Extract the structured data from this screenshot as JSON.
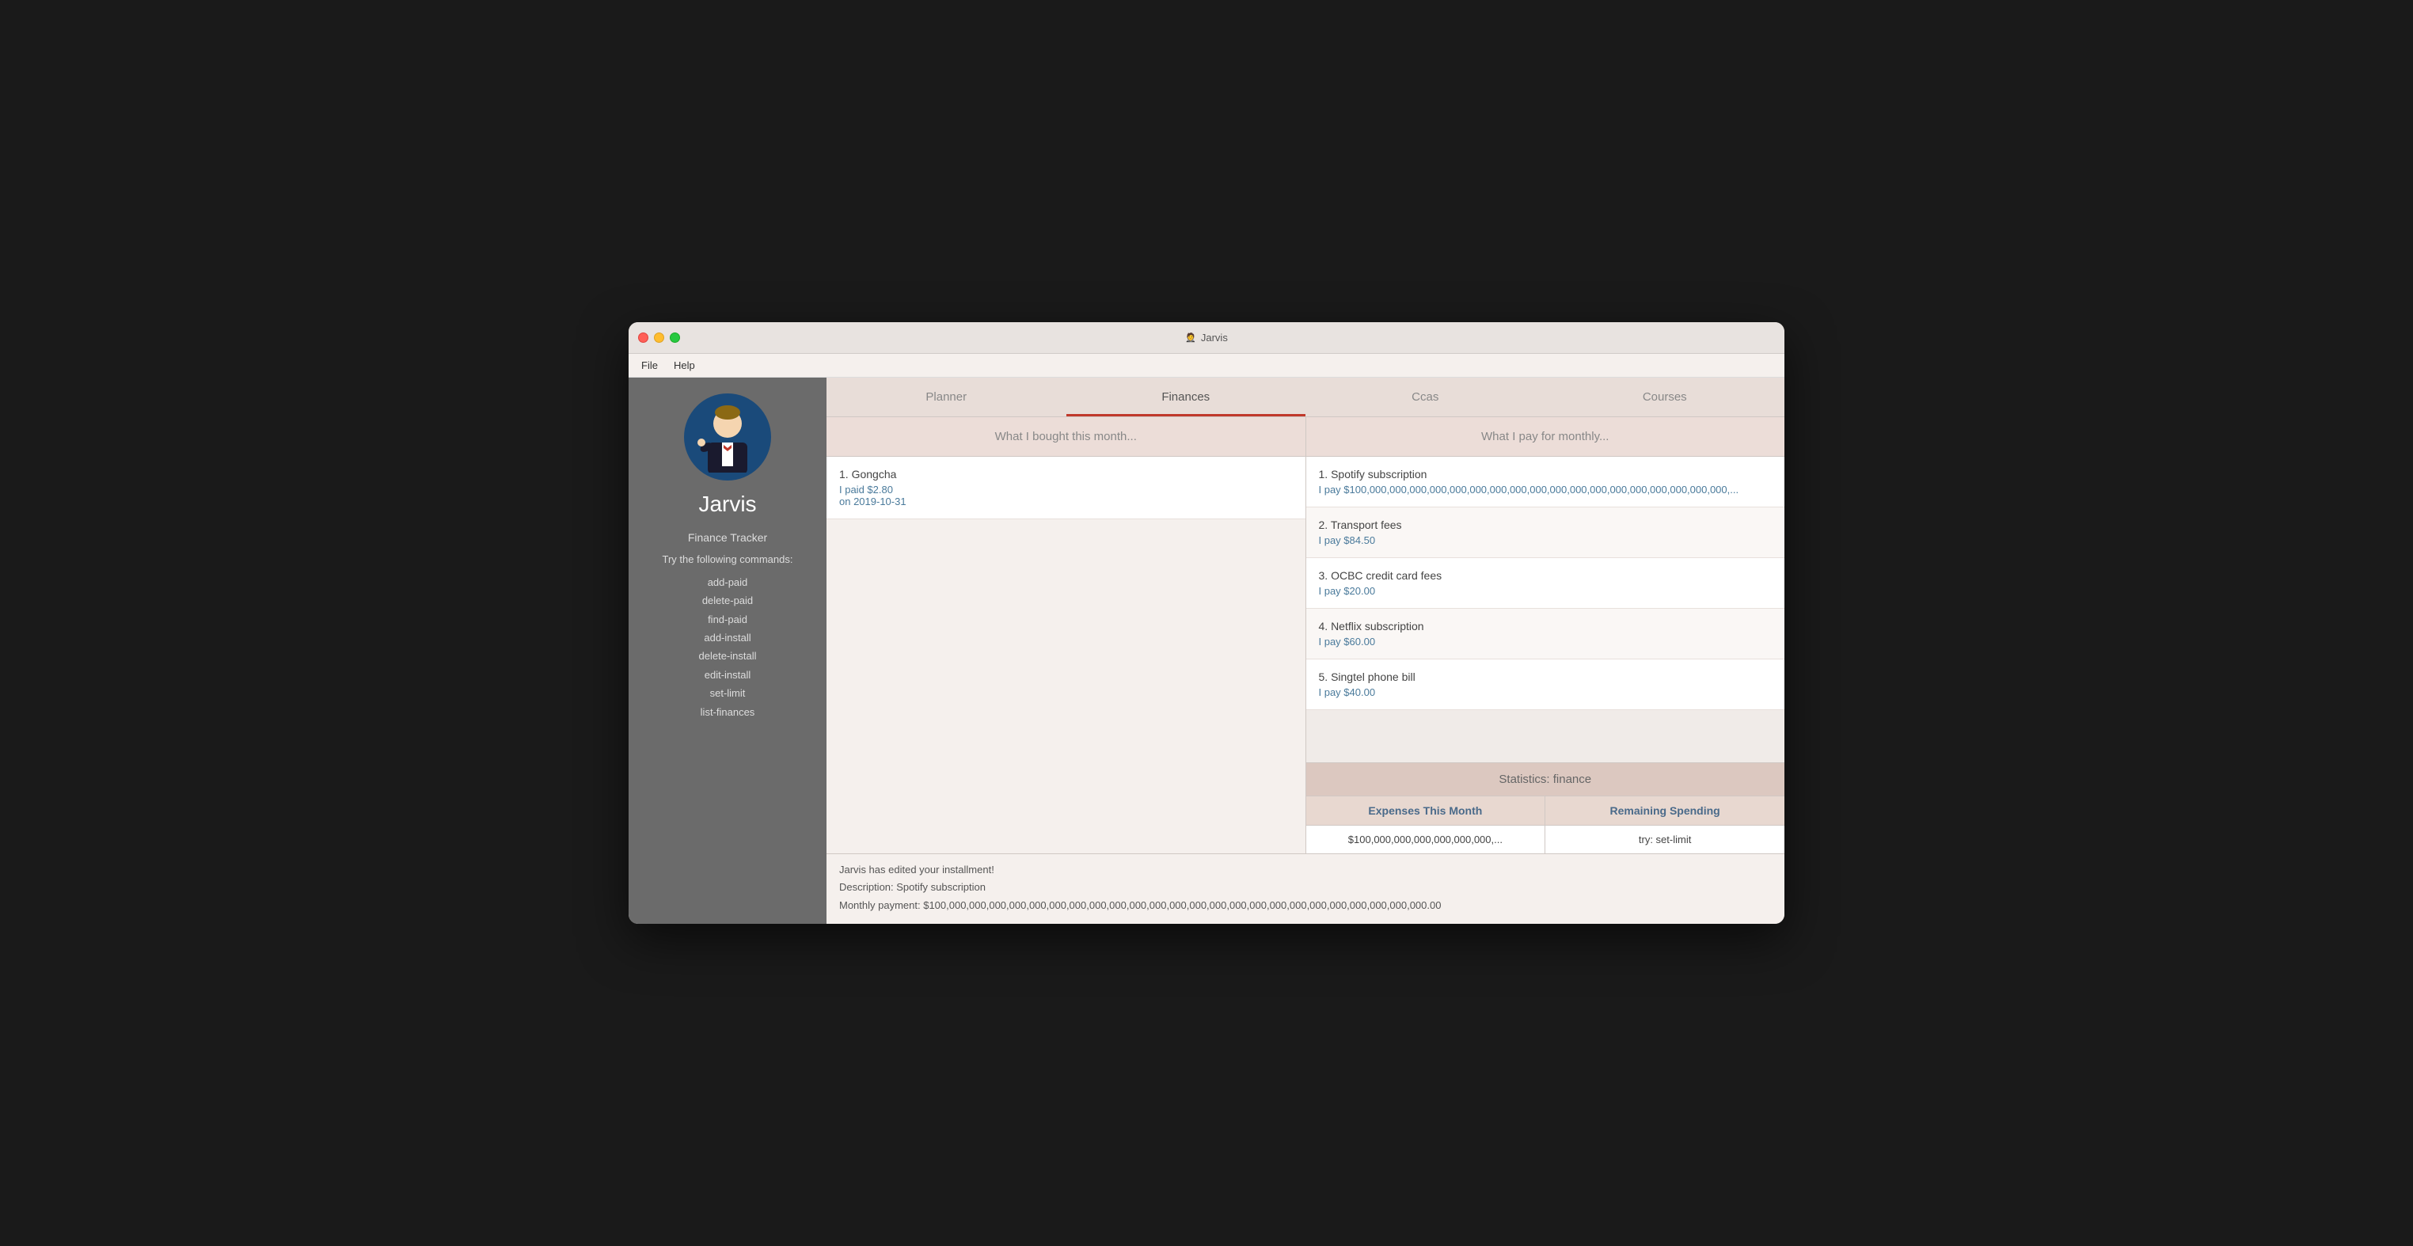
{
  "window": {
    "title": "Jarvis",
    "title_icon": "🤵"
  },
  "menubar": {
    "items": [
      "File",
      "Help"
    ]
  },
  "sidebar": {
    "name": "Jarvis",
    "section_title": "Finance Tracker",
    "commands_intro": "Try the following commands:",
    "commands": [
      "add-paid",
      "delete-paid",
      "find-paid",
      "add-install",
      "delete-install",
      "edit-install",
      "set-limit",
      "list-finances"
    ]
  },
  "tabs": [
    {
      "label": "Planner",
      "active": false
    },
    {
      "label": "Finances",
      "active": true
    },
    {
      "label": "Ccas",
      "active": false
    },
    {
      "label": "Courses",
      "active": false
    }
  ],
  "left_panel": {
    "header": "What I bought this month...",
    "items": [
      {
        "title": "1. Gongcha",
        "detail_line1": "I paid $2.80",
        "detail_line2": "on 2019-10-31"
      }
    ]
  },
  "right_panel": {
    "header": "What I pay for monthly...",
    "items": [
      {
        "title": "1. Spotify subscription",
        "detail": "I pay $100,000,000,000,000,000,000,000,000,000,000,000,000,000,000,000,000,000,000,..."
      },
      {
        "title": "2.  Transport fees",
        "detail": "I pay $84.50"
      },
      {
        "title": "3.  OCBC credit card fees",
        "detail": "I pay $20.00"
      },
      {
        "title": "4.  Netflix subscription",
        "detail": "I pay $60.00"
      },
      {
        "title": "5.  Singtel phone bill",
        "detail": "I pay $40.00"
      }
    ]
  },
  "statistics": {
    "header": "Statistics: finance",
    "col1_label": "Expenses This Month",
    "col2_label": "Remaining Spending",
    "col1_value": "$100,000,000,000,000,000,000,...",
    "col2_value": "try: set-limit"
  },
  "status_bar": {
    "line1": "Jarvis has edited your installment!",
    "line2": "Description: Spotify subscription",
    "line3": "Monthly payment: $100,000,000,000,000,000,000,000,000,000,000,000,000,000,000,000,000,000,000,000,000,000,000,000,000.00"
  }
}
